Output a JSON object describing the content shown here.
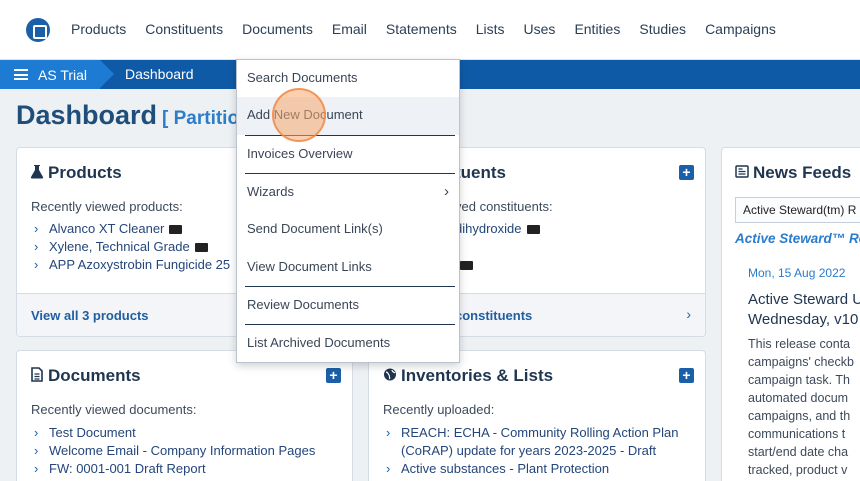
{
  "nav": {
    "items": [
      "Products",
      "Constituents",
      "Documents",
      "Email",
      "Statements",
      "Lists",
      "Uses",
      "Entities",
      "Studies",
      "Campaigns"
    ]
  },
  "breadcrumb": {
    "home": "AS Trial",
    "current": "Dashboard"
  },
  "page": {
    "title": "Dashboard",
    "subtitle": "[ Partitio"
  },
  "products_card": {
    "title": "Products",
    "recent_label": "Recently viewed products:",
    "items": [
      "Alvanco XT Cleaner",
      "Xylene, Technical Grade",
      "APP Azoxystrobin Fungicide 25"
    ],
    "footer": "View all 3 products"
  },
  "constituents_card": {
    "title": "tuents",
    "recent_label": "ved constituents:",
    "items": [
      "dihydroxide"
    ],
    "footer": "constituents"
  },
  "documents_card": {
    "title": "Documents",
    "recent_label": "Recently viewed documents:",
    "items": [
      "Test Document",
      "Welcome Email - Company Information Pages",
      "FW: 0001-001 Draft Report"
    ]
  },
  "inventories_card": {
    "title": "Inventories & Lists",
    "recent_label": "Recently uploaded:",
    "items": [
      "REACH: ECHA - Community Rolling Action Plan",
      "(CoRAP) update for years 2023-2025 - Draft",
      "Active substances - Plant Protection"
    ]
  },
  "news": {
    "title": "News Feeds",
    "select_value": "Active Steward(tm) R",
    "brand": "Active Steward™ Re",
    "date": "Mon, 15 Aug 2022",
    "headline": "Active Steward U Wednesday, v10",
    "body": [
      "This release conta",
      "campaigns' checkb",
      "campaign task. Th",
      "automated docum",
      "campaigns, and th",
      "communications t",
      "start/end date cha",
      "tracked, product v"
    ]
  },
  "dropdown": {
    "items": [
      "Search Documents",
      "Add New Document",
      "Invoices Overview",
      "Wizards",
      "Send Document Link(s)",
      "View Document Links",
      "Review Documents",
      "List Archived Documents"
    ]
  }
}
